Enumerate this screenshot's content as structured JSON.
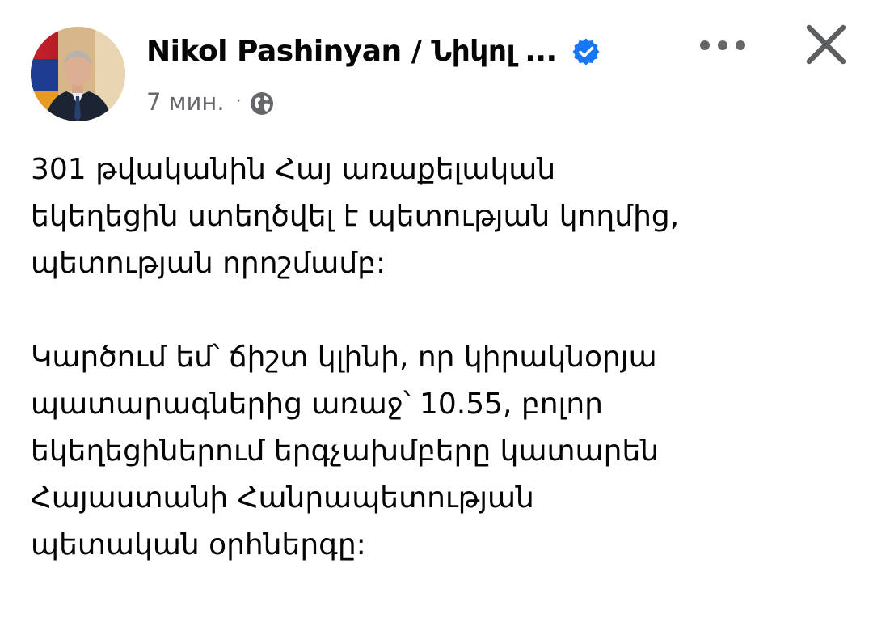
{
  "post": {
    "author": "Nikol Pashinyan / Նիկոլ ...",
    "timestamp": "7 мин.",
    "separator": "·",
    "icons": {
      "verified": "verified-badge-icon",
      "audience": "globe-icon",
      "more": "more-options-icon",
      "close": "close-icon"
    },
    "colors": {
      "text": "#050505",
      "meta": "#65676b",
      "verified": "#1877f2"
    },
    "paragraphs": [
      "301 թվականին Հայ առաքելական\nեկեղեցին ստեղծվել է պետության կողմից,\nպետության որոշմամբ:",
      "Կարծում եմ՝ ճիշտ կլինի, որ կիրակնօրյա\nպատարագներից առաջ՝ 10.55, բոլոր\nեկեղեցիներում երգչախմբերը կատարեն\nՀայաստանի Հանրապետության\nպետական օրհներգը:"
    ]
  }
}
